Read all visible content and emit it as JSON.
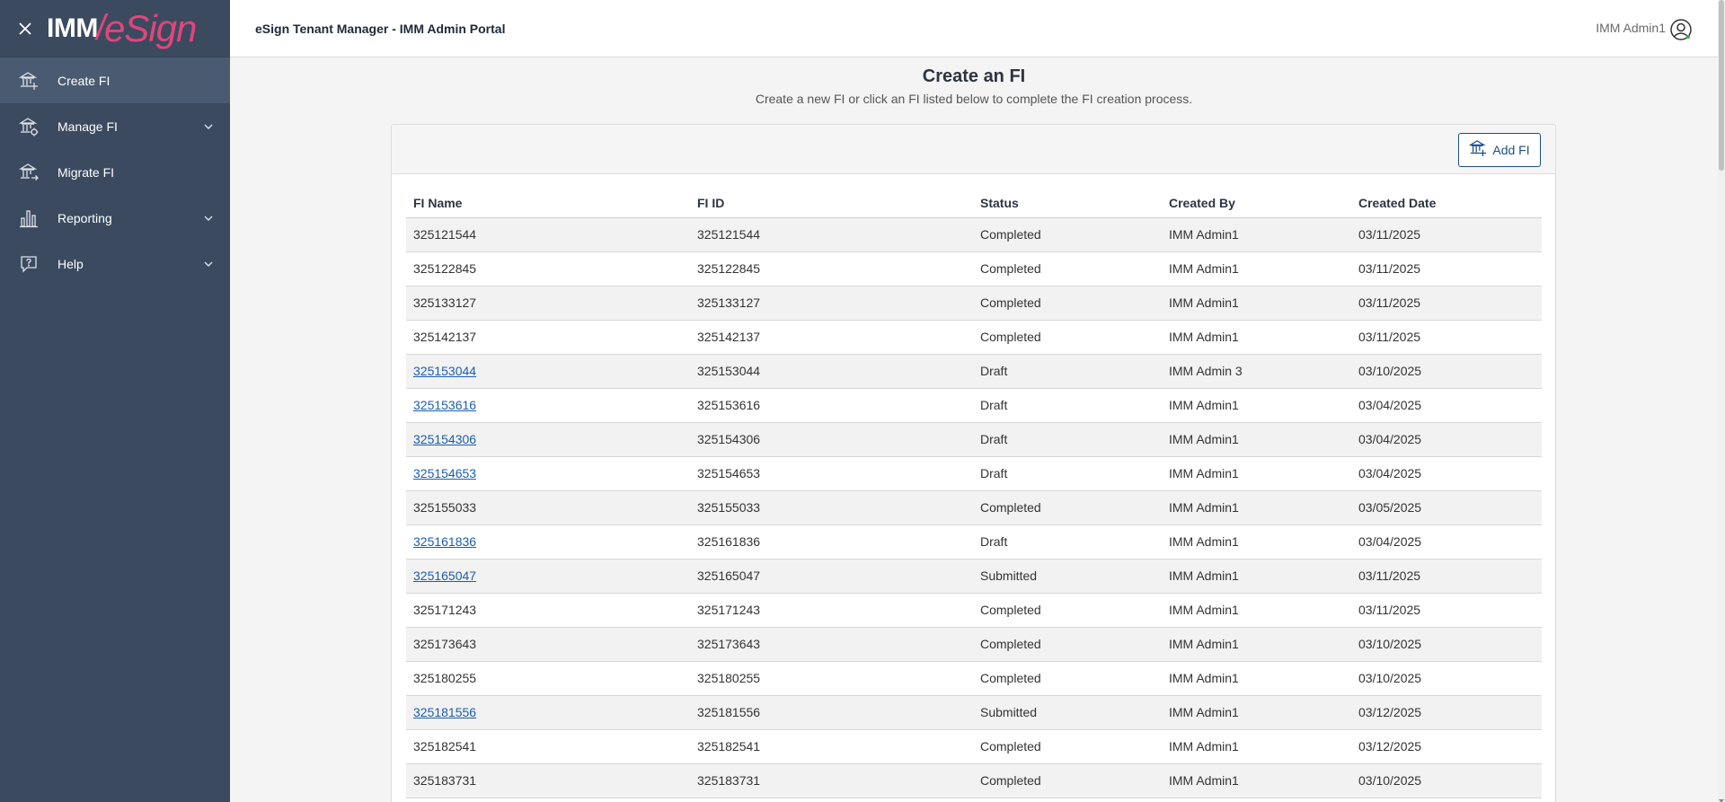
{
  "sidebar": {
    "logo": {
      "part1": "IMM",
      "part2": "eSign"
    },
    "items": [
      {
        "label": "Create FI",
        "icon": "bank-add-icon",
        "active": true,
        "expandable": false
      },
      {
        "label": "Manage FI",
        "icon": "bank-settings-icon",
        "active": false,
        "expandable": true
      },
      {
        "label": "Migrate FI",
        "icon": "bank-migrate-icon",
        "active": false,
        "expandable": false
      },
      {
        "label": "Reporting",
        "icon": "bar-chart-icon",
        "active": false,
        "expandable": true
      },
      {
        "label": "Help",
        "icon": "help-chat-icon",
        "active": false,
        "expandable": true
      }
    ]
  },
  "header": {
    "title": "eSign Tenant Manager - IMM Admin Portal",
    "user": "IMM Admin1"
  },
  "main": {
    "title": "Create an FI",
    "subtitle": "Create a new FI or click an FI listed below to complete the FI creation process.",
    "add_button": "Add FI",
    "table": {
      "columns": [
        "FI Name",
        "FI ID",
        "Status",
        "Created By",
        "Created Date"
      ],
      "rows": [
        {
          "name": "325121544",
          "id": "325121544",
          "status": "Completed",
          "created_by": "IMM Admin1",
          "date": "03/11/2025",
          "link": false
        },
        {
          "name": "325122845",
          "id": "325122845",
          "status": "Completed",
          "created_by": "IMM Admin1",
          "date": "03/11/2025",
          "link": false
        },
        {
          "name": "325133127",
          "id": "325133127",
          "status": "Completed",
          "created_by": "IMM Admin1",
          "date": "03/11/2025",
          "link": false
        },
        {
          "name": "325142137",
          "id": "325142137",
          "status": "Completed",
          "created_by": "IMM Admin1",
          "date": "03/11/2025",
          "link": false
        },
        {
          "name": "325153044",
          "id": "325153044",
          "status": "Draft",
          "created_by": "IMM Admin 3",
          "date": "03/10/2025",
          "link": true
        },
        {
          "name": "325153616",
          "id": "325153616",
          "status": "Draft",
          "created_by": "IMM Admin1",
          "date": "03/04/2025",
          "link": true
        },
        {
          "name": "325154306",
          "id": "325154306",
          "status": "Draft",
          "created_by": "IMM Admin1",
          "date": "03/04/2025",
          "link": true
        },
        {
          "name": "325154653",
          "id": "325154653",
          "status": "Draft",
          "created_by": "IMM Admin1",
          "date": "03/04/2025",
          "link": true
        },
        {
          "name": "325155033",
          "id": "325155033",
          "status": "Completed",
          "created_by": "IMM Admin1",
          "date": "03/05/2025",
          "link": false
        },
        {
          "name": "325161836",
          "id": "325161836",
          "status": "Draft",
          "created_by": "IMM Admin1",
          "date": "03/04/2025",
          "link": true
        },
        {
          "name": "325165047",
          "id": "325165047",
          "status": "Submitted",
          "created_by": "IMM Admin1",
          "date": "03/11/2025",
          "link": true
        },
        {
          "name": "325171243",
          "id": "325171243",
          "status": "Completed",
          "created_by": "IMM Admin1",
          "date": "03/11/2025",
          "link": false
        },
        {
          "name": "325173643",
          "id": "325173643",
          "status": "Completed",
          "created_by": "IMM Admin1",
          "date": "03/10/2025",
          "link": false
        },
        {
          "name": "325180255",
          "id": "325180255",
          "status": "Completed",
          "created_by": "IMM Admin1",
          "date": "03/10/2025",
          "link": false
        },
        {
          "name": "325181556",
          "id": "325181556",
          "status": "Submitted",
          "created_by": "IMM Admin1",
          "date": "03/12/2025",
          "link": true
        },
        {
          "name": "325182541",
          "id": "325182541",
          "status": "Completed",
          "created_by": "IMM Admin1",
          "date": "03/12/2025",
          "link": false
        },
        {
          "name": "325183731",
          "id": "325183731",
          "status": "Completed",
          "created_by": "IMM Admin1",
          "date": "03/10/2025",
          "link": false
        }
      ]
    }
  },
  "colors": {
    "sidebar_bg": "#3b4a5f",
    "sidebar_active": "#4a5a70",
    "link": "#1b5eab",
    "brand_pink": "#e0457b",
    "brand_purple": "#9a4ad0"
  }
}
